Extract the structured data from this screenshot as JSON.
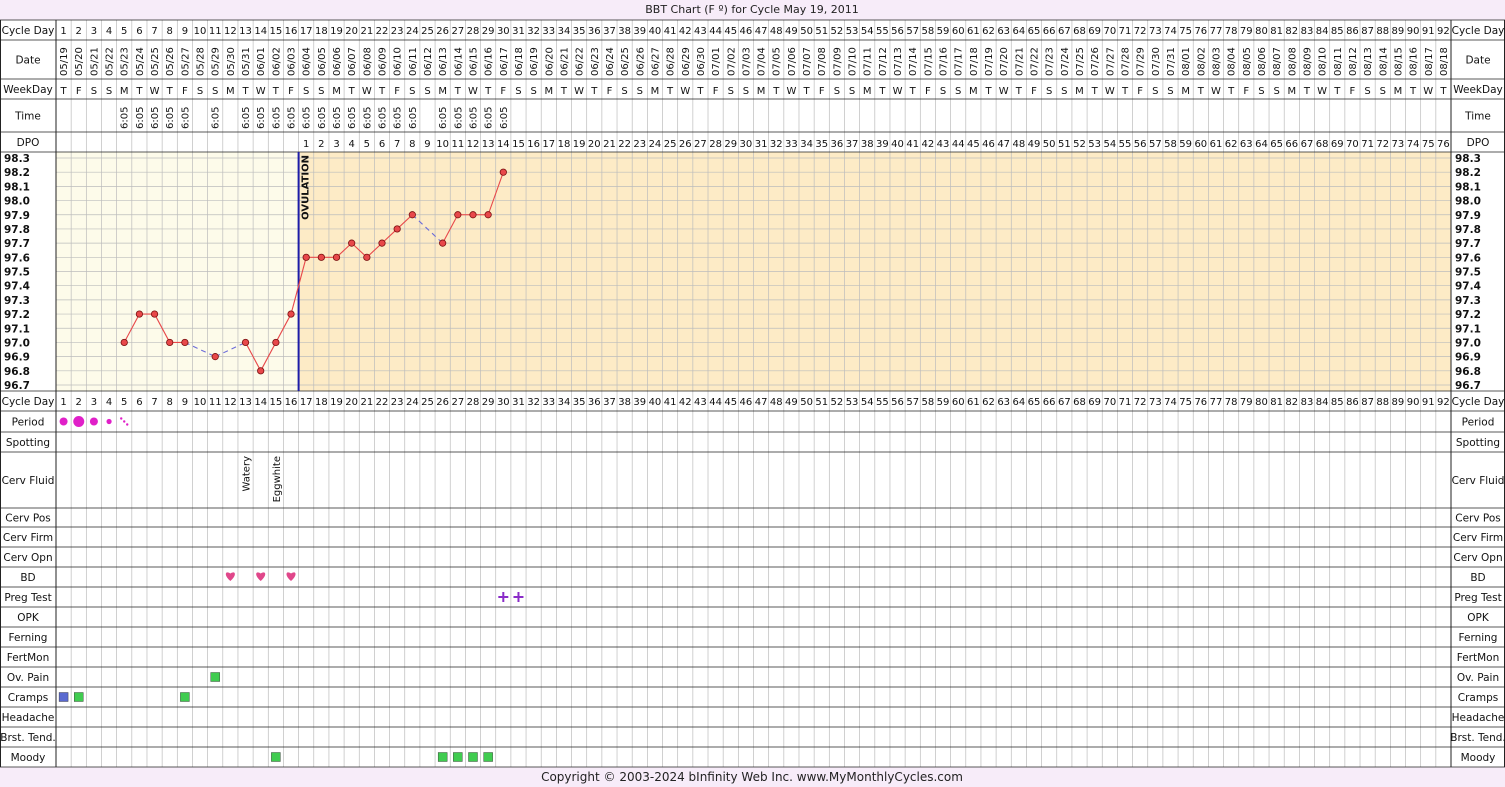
{
  "title": "BBT Chart (F º) for Cycle May 19, 2011",
  "copyright": "Copyright © 2003-2024 bInfinity Web Inc.      www.MyMonthlyCycles.com",
  "row_labels": {
    "cycle_day": "Cycle Day",
    "date": "Date",
    "weekday": "WeekDay",
    "time": "Time",
    "dpo": "DPO",
    "period": "Period",
    "spotting": "Spotting",
    "cerv_fluid": "Cerv Fluid",
    "cerv_pos": "Cerv Pos",
    "cerv_firm": "Cerv Firm",
    "cerv_opn": "Cerv Opn",
    "bd": "BD",
    "preg_test": "Preg Test",
    "opk": "OPK",
    "ferning": "Ferning",
    "fertmon": "FertMon",
    "ov_pain": "Ov. Pain",
    "cramps": "Cramps",
    "headache": "Headache",
    "brst_tend": "Brst. Tend.",
    "moody": "Moody"
  },
  "colors": {
    "pre_bg": "#fdfbea",
    "post_bg": "#fdebc6",
    "grid": "#bcbcbc",
    "border": "#222222",
    "temp_line": "#e8484a",
    "dash_line": "#6b6bd8",
    "ovulation": "#1c1ca8",
    "period": "#e020c8",
    "heart": "#e0478a",
    "plus": "#8a2cc8",
    "green": "#40cc50",
    "blue": "#5a6ad0"
  },
  "chart_data": {
    "type": "line",
    "ovulation_label": "OVULATION",
    "ovulation_day": 16,
    "cycle_days": [
      1,
      2,
      3,
      4,
      5,
      6,
      7,
      8,
      9,
      10,
      11,
      12,
      13,
      14,
      15,
      16,
      17,
      18,
      19,
      20,
      21,
      22,
      23,
      24,
      25,
      26,
      27,
      28,
      29,
      30,
      31,
      32,
      33,
      34,
      35,
      36,
      37,
      38,
      39,
      40,
      41,
      42,
      43,
      44,
      45,
      46,
      47,
      48,
      49,
      50,
      51,
      52,
      53,
      54,
      55,
      56,
      57,
      58,
      59,
      60,
      61,
      62,
      63,
      64,
      65,
      66,
      67,
      68,
      69,
      70,
      71,
      72,
      73,
      74,
      75,
      76,
      77,
      78,
      79,
      80,
      81,
      82,
      83,
      84,
      85,
      86,
      87,
      88,
      89,
      90,
      91,
      92
    ],
    "dates": [
      "05/19",
      "05/20",
      "05/21",
      "05/22",
      "05/23",
      "05/24",
      "05/25",
      "05/26",
      "05/27",
      "05/28",
      "05/29",
      "05/30",
      "05/31",
      "06/01",
      "06/02",
      "06/03",
      "06/04",
      "06/05",
      "06/06",
      "06/07",
      "06/08",
      "06/09",
      "06/10",
      "06/11",
      "06/12",
      "06/13",
      "06/14",
      "06/15",
      "06/16",
      "06/17",
      "06/18",
      "06/19",
      "06/20",
      "06/21",
      "06/22",
      "06/23",
      "06/24",
      "06/25",
      "06/26",
      "06/27",
      "06/28",
      "06/29",
      "06/30",
      "07/01",
      "07/02",
      "07/03",
      "07/04",
      "07/05",
      "07/06",
      "07/07",
      "07/08",
      "07/09",
      "07/10",
      "07/11",
      "07/12",
      "07/13",
      "07/14",
      "07/15",
      "07/16",
      "07/17",
      "07/18",
      "07/19",
      "07/20",
      "07/21",
      "07/22",
      "07/23",
      "07/24",
      "07/25",
      "07/26",
      "07/27",
      "07/28",
      "07/29",
      "07/30",
      "07/31",
      "08/01",
      "08/02",
      "08/03",
      "08/04",
      "08/05",
      "08/06",
      "08/07",
      "08/08",
      "08/09",
      "08/10",
      "08/11",
      "08/12",
      "08/13",
      "08/14",
      "08/15",
      "08/16",
      "08/17",
      "08/18"
    ],
    "weekdays": [
      "T",
      "F",
      "S",
      "S",
      "M",
      "T",
      "W",
      "T",
      "F",
      "S",
      "S",
      "M",
      "T",
      "W",
      "T",
      "F",
      "S",
      "S",
      "M",
      "T",
      "W",
      "T",
      "F",
      "S",
      "S",
      "M",
      "T",
      "W",
      "T",
      "F",
      "S",
      "S",
      "M",
      "T",
      "W",
      "T",
      "F",
      "S",
      "S",
      "M",
      "T",
      "W",
      "T",
      "F",
      "S",
      "S",
      "M",
      "T",
      "W",
      "T",
      "F",
      "S",
      "S",
      "M",
      "T",
      "W",
      "T",
      "F",
      "S",
      "S",
      "M",
      "T",
      "W",
      "T",
      "F",
      "S",
      "S",
      "M",
      "T",
      "W",
      "T",
      "F",
      "S",
      "S",
      "M",
      "T",
      "W",
      "T",
      "F",
      "S",
      "S",
      "M",
      "T",
      "W",
      "T",
      "F",
      "S",
      "S",
      "M",
      "T",
      "W",
      "T"
    ],
    "times": [
      "",
      "",
      "",
      "",
      "6:05",
      "6:05",
      "6:05",
      "6:05",
      "6:05",
      "",
      "6:05",
      "",
      "6:05",
      "6:05",
      "6:05",
      "6:05",
      "6:05",
      "6:05",
      "6:05",
      "6:05",
      "6:05",
      "6:05",
      "6:05",
      "6:05",
      "",
      "6:05",
      "6:05",
      "6:05",
      "6:05",
      "6:05"
    ],
    "dpo": [
      1,
      2,
      3,
      4,
      5,
      6,
      7,
      8,
      9,
      10,
      11,
      12,
      13,
      14,
      15,
      16,
      17,
      18,
      19,
      20,
      21,
      22,
      23,
      24,
      25,
      26,
      27,
      28,
      29,
      30,
      31,
      32,
      33,
      34,
      35,
      36,
      37,
      38,
      39,
      40,
      41,
      42,
      43,
      44,
      45,
      46,
      47,
      48,
      49,
      50,
      51,
      52,
      53,
      54,
      55,
      56,
      57,
      58,
      59,
      60,
      61,
      62,
      63,
      64,
      65,
      66,
      67,
      68,
      69,
      70,
      71,
      72,
      73,
      74,
      75,
      76
    ],
    "y_ticks": [
      "98.3",
      "98.2",
      "98.1",
      "98.0",
      "97.9",
      "97.8",
      "97.7",
      "97.6",
      "97.5",
      "97.4",
      "97.3",
      "97.2",
      "97.1",
      "97.0",
      "96.9",
      "96.8",
      "96.7"
    ],
    "ylim": [
      96.7,
      98.3
    ],
    "temperatures": [
      {
        "day": 5,
        "temp": 97.0
      },
      {
        "day": 6,
        "temp": 97.2
      },
      {
        "day": 7,
        "temp": 97.2
      },
      {
        "day": 8,
        "temp": 97.0
      },
      {
        "day": 9,
        "temp": 97.0
      },
      {
        "day": 11,
        "temp": 96.9
      },
      {
        "day": 13,
        "temp": 97.0
      },
      {
        "day": 14,
        "temp": 96.8
      },
      {
        "day": 15,
        "temp": 97.0
      },
      {
        "day": 16,
        "temp": 97.2
      },
      {
        "day": 17,
        "temp": 97.6
      },
      {
        "day": 18,
        "temp": 97.6
      },
      {
        "day": 19,
        "temp": 97.6
      },
      {
        "day": 20,
        "temp": 97.7
      },
      {
        "day": 21,
        "temp": 97.6
      },
      {
        "day": 22,
        "temp": 97.7
      },
      {
        "day": 23,
        "temp": 97.8
      },
      {
        "day": 24,
        "temp": 97.9
      },
      {
        "day": 26,
        "temp": 97.7
      },
      {
        "day": 27,
        "temp": 97.9
      },
      {
        "day": 28,
        "temp": 97.9
      },
      {
        "day": 29,
        "temp": 97.9
      },
      {
        "day": 30,
        "temp": 98.2
      }
    ],
    "period": [
      {
        "day": 1,
        "level": "medium"
      },
      {
        "day": 2,
        "level": "heavy"
      },
      {
        "day": 3,
        "level": "medium"
      },
      {
        "day": 4,
        "level": "light"
      },
      {
        "day": 5,
        "level": "spotting"
      }
    ],
    "cerv_fluid": [
      {
        "day": 13,
        "label": "Watery"
      },
      {
        "day": 15,
        "label": "Eggwhite"
      }
    ],
    "bd": [
      12,
      14,
      16
    ],
    "preg_test": [
      30,
      31
    ],
    "ov_pain": [
      11
    ],
    "cramps": [
      {
        "day": 1,
        "color": "blue"
      },
      {
        "day": 2,
        "color": "green"
      },
      {
        "day": 9,
        "color": "green"
      }
    ],
    "moody": [
      15,
      26,
      27,
      28,
      29
    ]
  }
}
